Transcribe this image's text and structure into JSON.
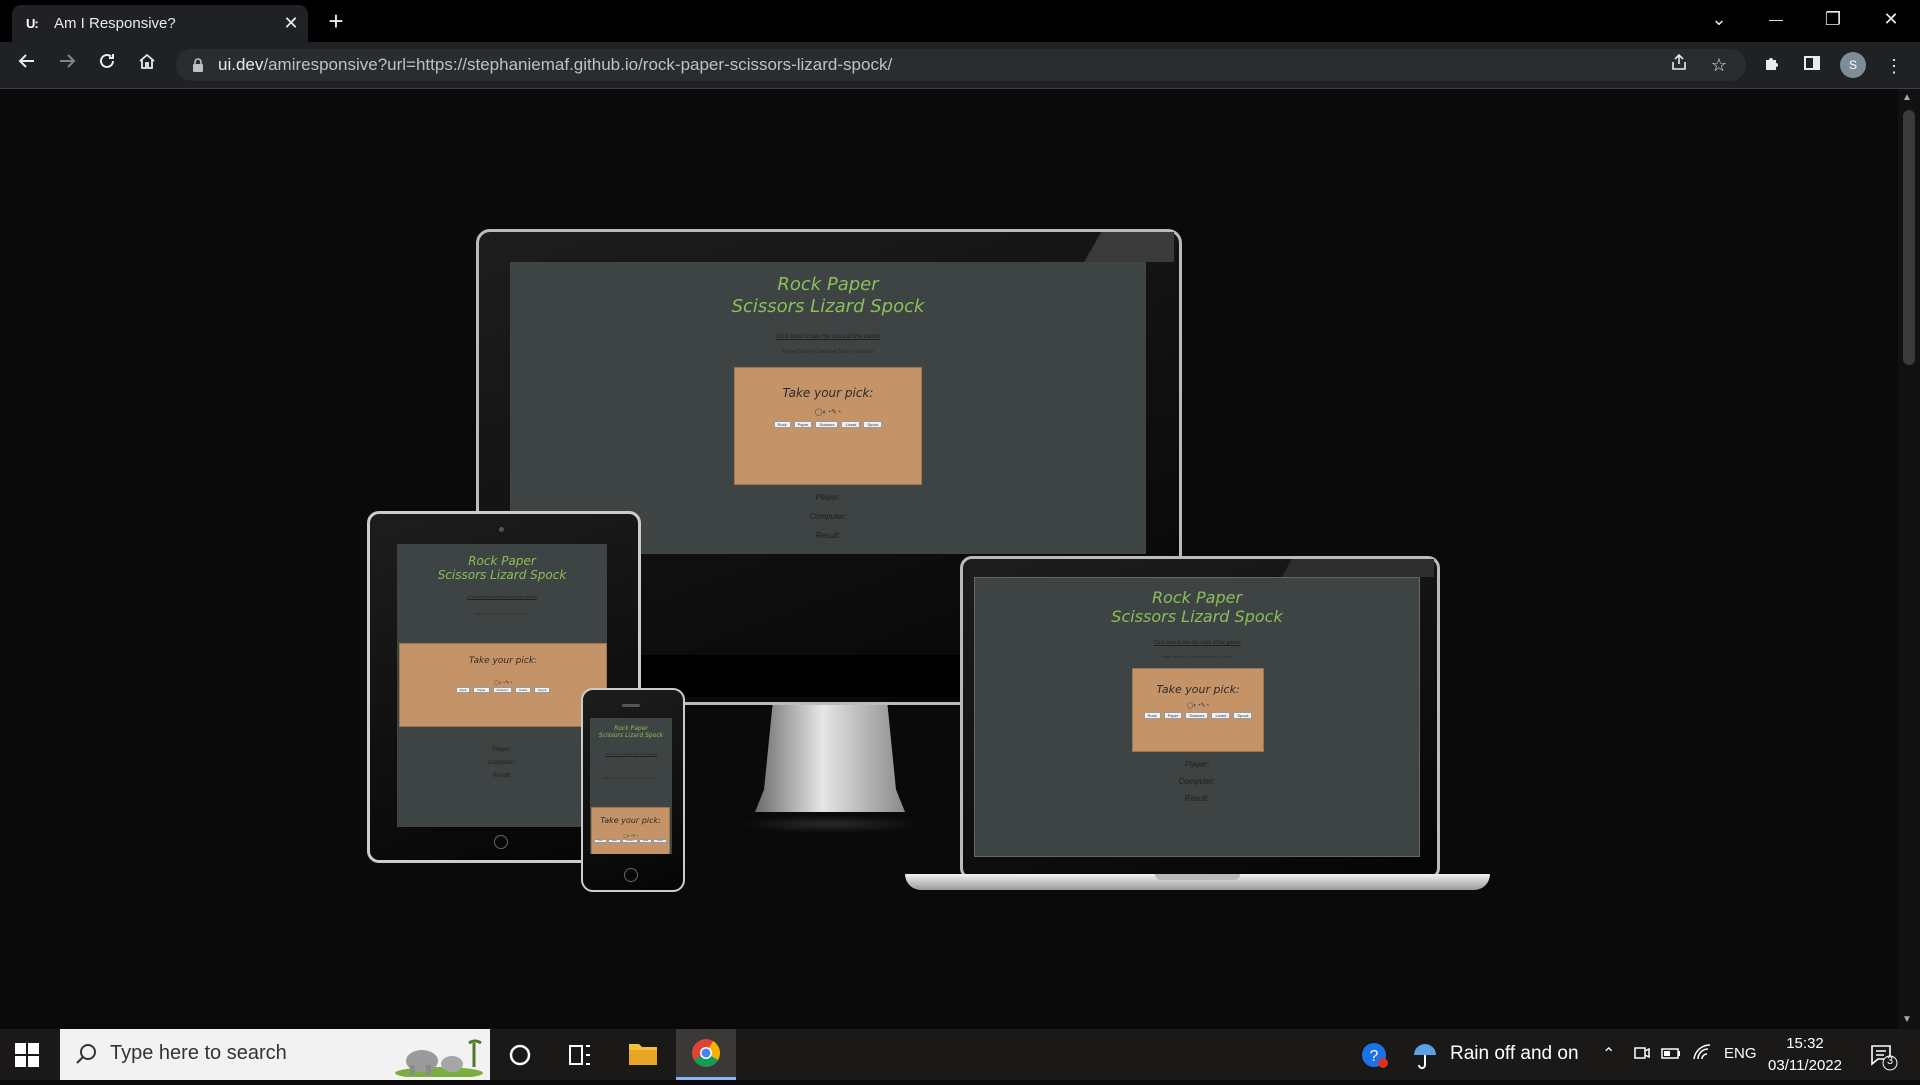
{
  "browser": {
    "tab": {
      "favicon_text": "U:",
      "title": "Am I Responsive?",
      "close": "✕"
    },
    "new_tab": "+",
    "window_controls": {
      "tab_search": "⌄",
      "minimize": "—",
      "restore": "❐",
      "close": "✕"
    },
    "url_host": "ui.dev",
    "url_rest": "/amiresponsive?url=https://stephaniemaf.github.io/rock-paper-scissors-lizard-spock/",
    "profile_initial": "S"
  },
  "site": {
    "title_line1": "Rock Paper",
    "title_line2": "Scissors Lizard Spock",
    "rules_link": "Click here to see the rules of the game!",
    "score": "Player Score | Computer Score | Draws 0",
    "pick_title": "Take your pick:",
    "glyphs": "◯◐◔✎◔",
    "choices": [
      "Rock",
      "Paper",
      "Scissors",
      "Lizard",
      "Spock"
    ],
    "player": "Player:",
    "computer": "Computer:",
    "result": "Result:"
  },
  "taskbar": {
    "search_placeholder": "Type here to search",
    "weather": "Rain off and on",
    "language": "ENG",
    "time": "15:32",
    "date": "03/11/2022",
    "notifications": "3"
  },
  "colors": {
    "site_background": "#3d4443",
    "title_green": "#8dbe5a",
    "pick_box": "#c49468"
  }
}
